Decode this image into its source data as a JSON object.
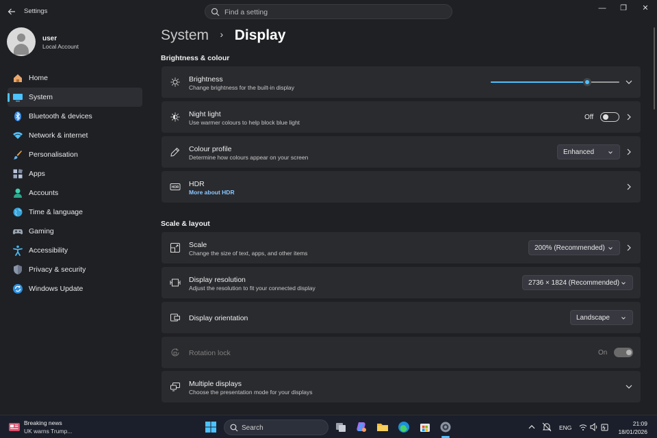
{
  "window": {
    "title": "Settings",
    "search_placeholder": "Find a setting",
    "minimize": "—",
    "maximize": "❐",
    "close": "✕"
  },
  "profile": {
    "name": "user",
    "account_type": "Local Account"
  },
  "sidebar": {
    "items": [
      {
        "label": "Home",
        "icon": "home-icon"
      },
      {
        "label": "System",
        "icon": "system-icon",
        "active": true
      },
      {
        "label": "Bluetooth & devices",
        "icon": "bluetooth-icon"
      },
      {
        "label": "Network & internet",
        "icon": "wifi-icon"
      },
      {
        "label": "Personalisation",
        "icon": "brush-icon"
      },
      {
        "label": "Apps",
        "icon": "apps-icon"
      },
      {
        "label": "Accounts",
        "icon": "accounts-icon"
      },
      {
        "label": "Time & language",
        "icon": "globe-icon"
      },
      {
        "label": "Gaming",
        "icon": "gaming-icon"
      },
      {
        "label": "Accessibility",
        "icon": "accessibility-icon"
      },
      {
        "label": "Privacy & security",
        "icon": "shield-icon"
      },
      {
        "label": "Windows Update",
        "icon": "update-icon"
      }
    ]
  },
  "breadcrumb": {
    "parent": "System",
    "separator": "›",
    "current": "Display"
  },
  "sections": {
    "brightness": {
      "title": "Brightness & colour",
      "brightness": {
        "title": "Brightness",
        "subtitle": "Change brightness for the built-in display",
        "value": 0.75
      },
      "night_light": {
        "title": "Night light",
        "subtitle": "Use warmer colours to help block blue light",
        "state": "Off"
      },
      "colour_profile": {
        "title": "Colour profile",
        "subtitle": "Determine how colours appear on your screen",
        "value": "Enhanced"
      },
      "hdr": {
        "title": "HDR",
        "link": "More about HDR"
      }
    },
    "scale_layout": {
      "title": "Scale & layout",
      "scale": {
        "title": "Scale",
        "subtitle": "Change the size of text, apps, and other items",
        "value": "200% (Recommended)"
      },
      "resolution": {
        "title": "Display resolution",
        "subtitle": "Adjust the resolution to fit your connected display",
        "value": "2736 × 1824 (Recommended)"
      },
      "orientation": {
        "title": "Display orientation",
        "value": "Landscape"
      },
      "rotation_lock": {
        "title": "Rotation lock",
        "state": "On"
      },
      "multiple_displays": {
        "title": "Multiple displays",
        "subtitle": "Choose the presentation mode for your displays"
      }
    }
  },
  "taskbar": {
    "news_title": "Breaking news",
    "news_subtitle": "UK warns Trump...",
    "search_label": "Search",
    "language": "ENG",
    "time": "21:09",
    "date": "18/01/2026"
  },
  "colors": {
    "accent": "#4cc2ff",
    "card": "#2a2b2f",
    "background": "#1e2024"
  }
}
